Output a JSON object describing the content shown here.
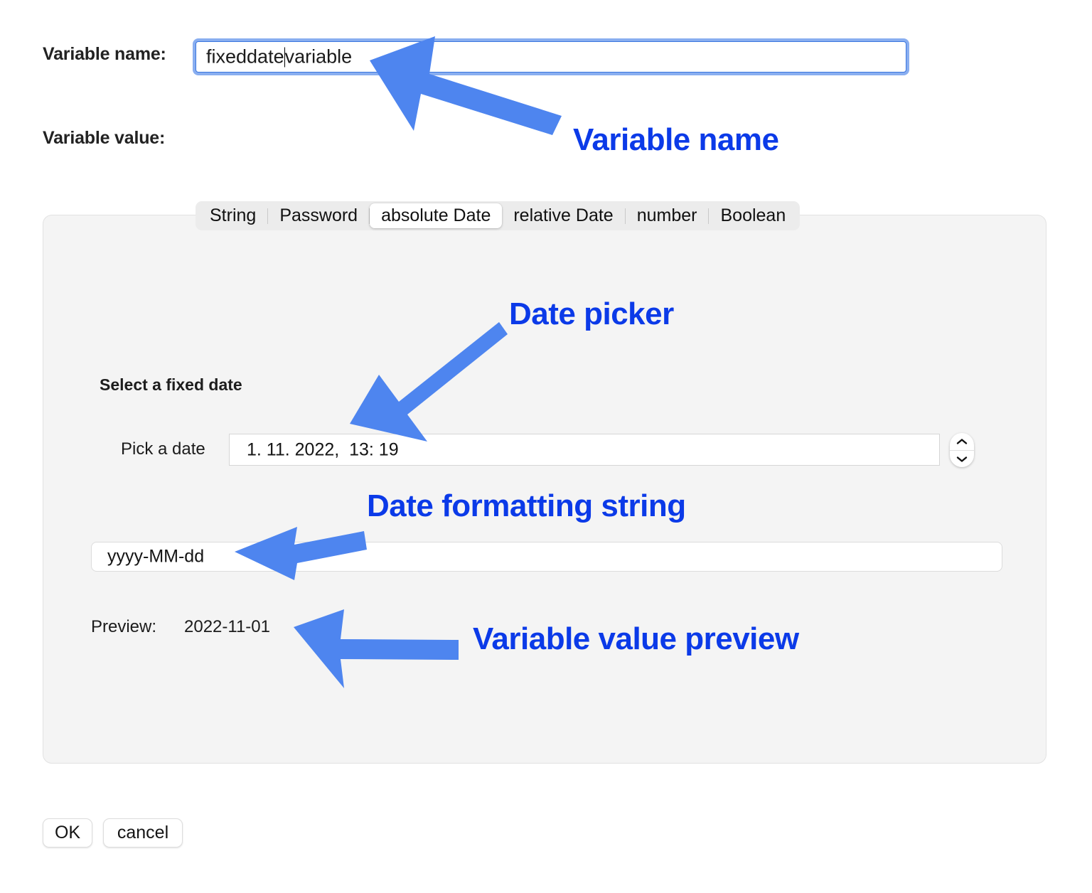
{
  "dialog": {
    "variable_name_label": "Variable name:",
    "variable_value_label": "Variable value:",
    "variable_name_before_caret": "fixeddate",
    "variable_name_after_caret": "variable"
  },
  "tabs": [
    {
      "label": "String",
      "selected": false
    },
    {
      "label": "Password",
      "selected": false
    },
    {
      "label": "absolute Date",
      "selected": true
    },
    {
      "label": "relative Date",
      "selected": false
    },
    {
      "label": "number",
      "selected": false
    },
    {
      "label": "Boolean",
      "selected": false
    }
  ],
  "panel": {
    "section_title": "Select a fixed date",
    "pick_a_date_label": "Pick a date",
    "pick_a_date_value": "1. 11. 2022,  13: 19",
    "stepper_up_icon": "chevron-up-icon",
    "stepper_down_icon": "chevron-down-icon",
    "format_value": "yyyy-MM-dd",
    "preview_label": "Preview:",
    "preview_value": "2022-11-01"
  },
  "footer": {
    "ok_label": "OK",
    "cancel_label": "cancel"
  },
  "annotations": [
    {
      "text": "Variable name"
    },
    {
      "text": "Date picker"
    },
    {
      "text": "Date formatting string"
    },
    {
      "text": "Variable value preview"
    }
  ],
  "colors": {
    "annotation_text": "#0b3ae8",
    "annotation_arrow": "#4e85ef",
    "focus_ring": "#89aef0",
    "panel_background": "#f4f4f4",
    "page_background": "#ffffff"
  }
}
